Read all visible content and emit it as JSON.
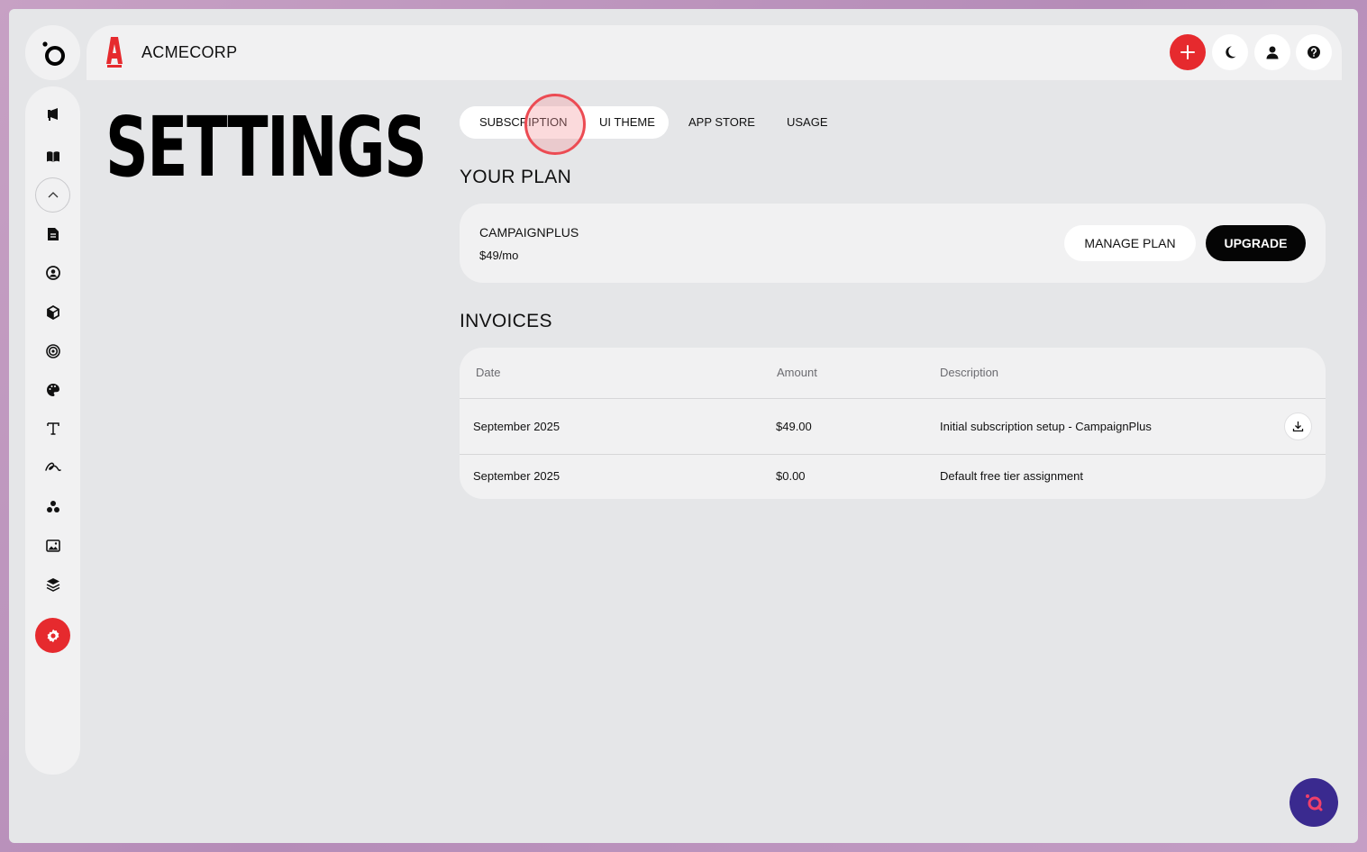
{
  "app": {
    "company_name": "ACMECORP",
    "brand_accent": "#e62a2e"
  },
  "header": {
    "icons": [
      "plus-icon",
      "moon-icon",
      "user-icon",
      "help-icon"
    ]
  },
  "sidebar": {
    "items": [
      {
        "icon": "megaphone-icon"
      },
      {
        "icon": "book-icon"
      },
      {
        "icon": "chevron-up-icon"
      },
      {
        "icon": "document-icon"
      },
      {
        "icon": "user-circle-icon"
      },
      {
        "icon": "cube-icon"
      },
      {
        "icon": "target-icon"
      },
      {
        "icon": "palette-icon"
      },
      {
        "icon": "text-icon"
      },
      {
        "icon": "signature-icon"
      },
      {
        "icon": "community-icon"
      },
      {
        "icon": "image-icon"
      },
      {
        "icon": "layers-icon"
      },
      {
        "icon": "settings-gear-icon",
        "active": true
      }
    ]
  },
  "page": {
    "title": "SETTINGS"
  },
  "tabs": [
    {
      "label": "SUBSCRIPTION",
      "selected": true
    },
    {
      "label": "UI THEME"
    },
    {
      "label": "APP STORE"
    },
    {
      "label": "USAGE"
    }
  ],
  "plan": {
    "heading": "YOUR PLAN",
    "name": "CAMPAIGNPLUS",
    "price": "$49/mo",
    "manage_label": "MANAGE PLAN",
    "upgrade_label": "UPGRADE"
  },
  "invoices": {
    "heading": "INVOICES",
    "columns": [
      "Date",
      "Amount",
      "Description"
    ],
    "rows": [
      {
        "date": "September 2025",
        "amount": "$49.00",
        "description": "Initial subscription setup - CampaignPlus",
        "downloadable": true
      },
      {
        "date": "September 2025",
        "amount": "$0.00",
        "description": "Default free tier assignment",
        "downloadable": false
      }
    ]
  }
}
